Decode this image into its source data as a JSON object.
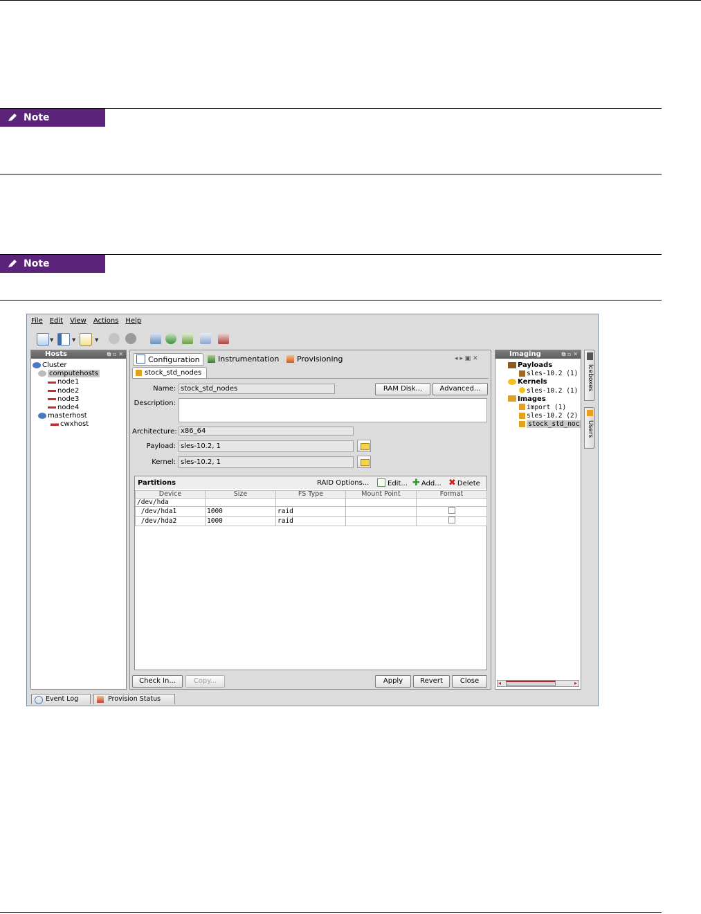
{
  "notes": [
    {
      "label": "Note"
    },
    {
      "label": "Note"
    }
  ],
  "app": {
    "menu": [
      "File",
      "Edit",
      "View",
      "Actions",
      "Help"
    ],
    "hosts_panel": {
      "title": "Hosts",
      "tree": [
        "Cluster",
        "computehosts",
        "node1",
        "node2",
        "node3",
        "node4",
        "masterhost",
        "cwxhost"
      ]
    },
    "center": {
      "tabs": [
        "Configuration",
        "Instrumentation",
        "Provisioning"
      ],
      "doc_tab": "stock_std_nodes",
      "name_label": "Name:",
      "name_value": "stock_std_nodes",
      "ramdisk_button": "RAM Disk...",
      "advanced_button": "Advanced...",
      "description_label": "Description:",
      "architecture_label": "Architecture:",
      "architecture_value": "x86_64",
      "payload_label": "Payload:",
      "payload_value": "sles-10.2, 1",
      "kernel_label": "Kernel:",
      "kernel_value": "sles-10.2, 1",
      "partitions": {
        "title": "Partitions",
        "raid_options": "RAID Options...",
        "edit": "Edit...",
        "add": "Add...",
        "delete": "Delete",
        "columns": [
          "Device",
          "Size",
          "FS Type",
          "Mount Point",
          "Format"
        ],
        "rows": [
          {
            "device": "/dev/hda",
            "size": "",
            "fs": "",
            "mount": "",
            "format": false
          },
          {
            "device": " /dev/hda1",
            "size": "1000",
            "fs": "raid",
            "mount": "",
            "format": true
          },
          {
            "device": " /dev/hda2",
            "size": "1000",
            "fs": "raid",
            "mount": "",
            "format": true
          }
        ]
      },
      "checkin_button": "Check In...",
      "copy_button": "Copy...",
      "apply_button": "Apply",
      "revert_button": "Revert",
      "close_button": "Close"
    },
    "imaging_panel": {
      "title": "Imaging",
      "tree": [
        "Payloads",
        "sles-10.2 (1)",
        "Kernels",
        "sles-10.2 (1)",
        "Images",
        "import (1)",
        "sles-10.2 (2)",
        "stock_std_noc"
      ]
    },
    "side_tabs": [
      "Iceboxes",
      "Users"
    ],
    "bottom_tabs": [
      "Event Log",
      "Provision Status"
    ],
    "colors": {
      "note_badge": "#5b2379",
      "panel_title": "#6a6a6a",
      "selection": "#c8c8c8"
    }
  }
}
